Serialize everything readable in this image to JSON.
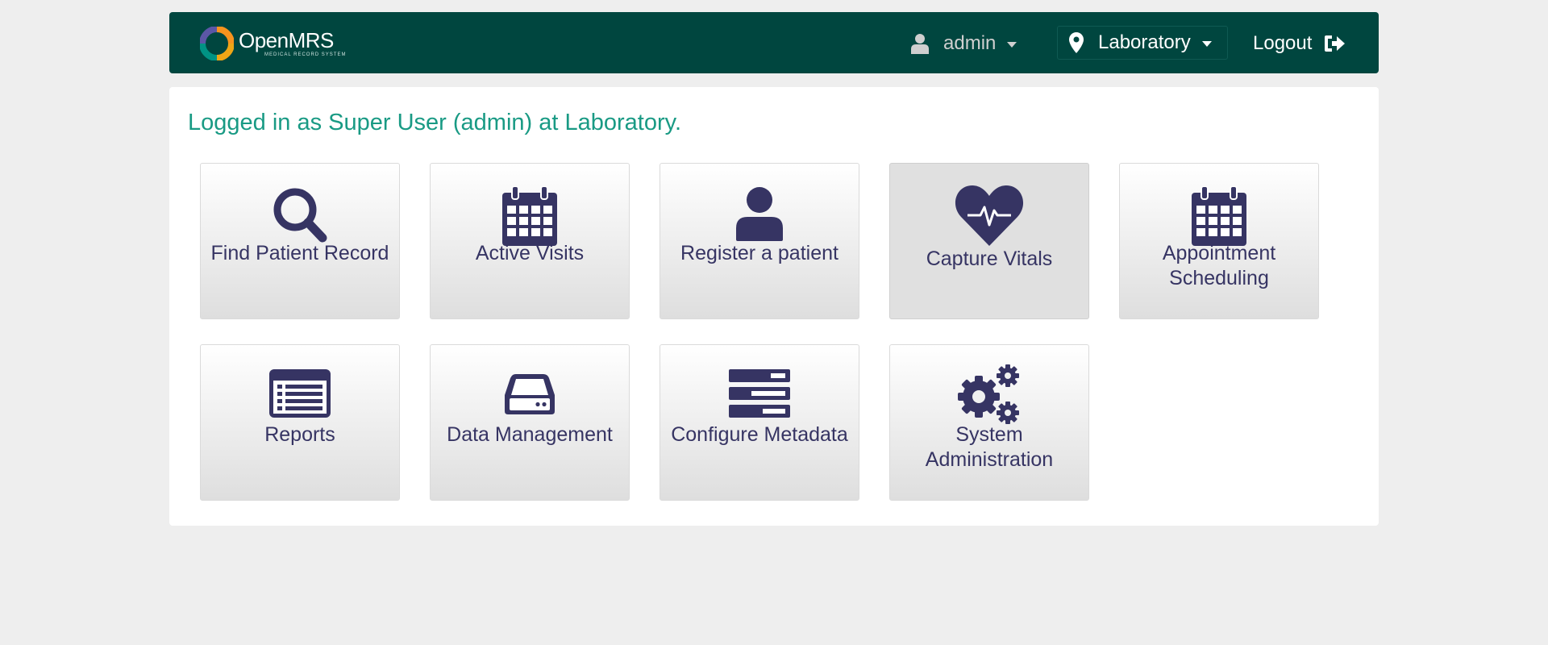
{
  "app": {
    "brand_name": "OpenMRS",
    "brand_tagline": "MEDICAL RECORD SYSTEM"
  },
  "header": {
    "user_label": "admin",
    "location_label": "Laboratory",
    "logout_label": "Logout"
  },
  "main": {
    "welcome_text": "Logged in as Super User (admin) at Laboratory.",
    "tiles": [
      {
        "label": "Find Patient Record",
        "icon": "search-icon"
      },
      {
        "label": "Active Visits",
        "icon": "calendar-icon"
      },
      {
        "label": "Register a patient",
        "icon": "user-icon"
      },
      {
        "label": "Capture Vitals",
        "icon": "heartbeat-icon"
      },
      {
        "label": "Appointment Scheduling",
        "icon": "calendar-icon"
      },
      {
        "label": "Reports",
        "icon": "list-alt-icon"
      },
      {
        "label": "Data Management",
        "icon": "hdd-icon"
      },
      {
        "label": "Configure Metadata",
        "icon": "tasks-icon"
      },
      {
        "label": "System Administration",
        "icon": "cogs-icon"
      }
    ]
  },
  "colors": {
    "header_bg": "#00463f",
    "page_bg": "#eeeeee",
    "welcome_text": "#199a84",
    "tile_icon": "#363463",
    "logo_orange": "#f7931e",
    "logo_teal": "#009384",
    "logo_purple": "#5b57a6",
    "logo_yellow": "#eea616"
  }
}
